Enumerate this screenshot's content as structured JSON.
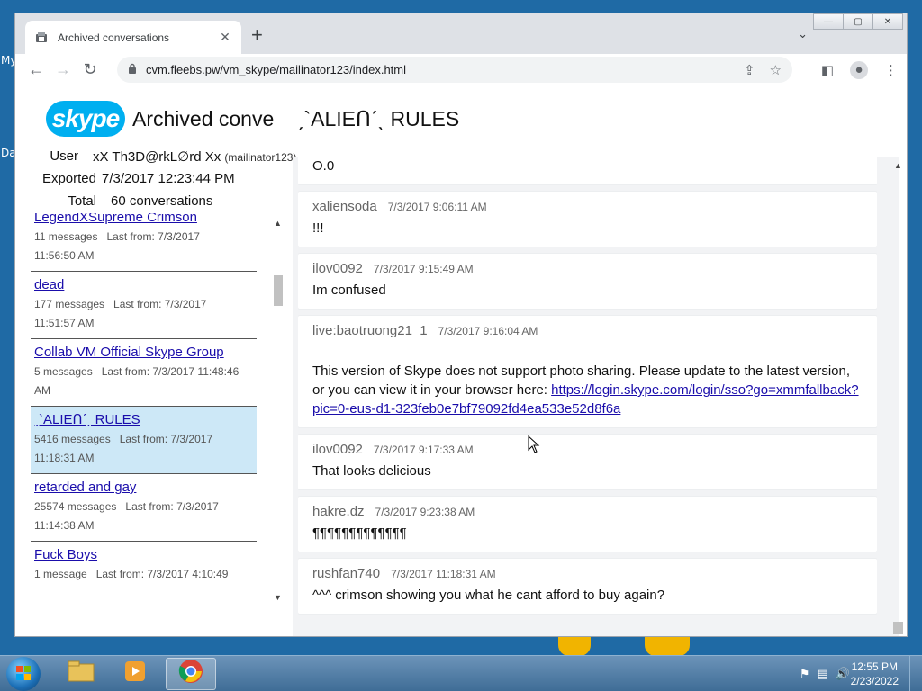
{
  "desktop": {
    "label_top": "My",
    "label_mid": "Da"
  },
  "browser": {
    "tab": {
      "title": "Archived conversations",
      "close": "✕"
    },
    "new_tab": "+",
    "tab_search": "⌄",
    "window_controls": {
      "minimize": "—",
      "maximize": "▢",
      "close": "✕"
    },
    "nav": {
      "back": "←",
      "forward": "→",
      "reload": "↻"
    },
    "address": {
      "lock": "🔒",
      "url": "cvm.fleebs.pw/vm_skype/mailinator123/index.html"
    }
  },
  "page": {
    "logo": "skype",
    "title": "Archived conve    ˏ`ALIEՈˊˎ RULES",
    "meta": {
      "user_key": "User",
      "user_val": "xX Th3D@rkL∅rd Xx",
      "user_id": "(mailinator123)",
      "exported_key": "Exported",
      "exported_val": "7/3/2017 12:23:44 PM",
      "total_key": "Total",
      "total_val": "60 conversations"
    },
    "conversations": [
      {
        "name": "LegendXSupreme Crimson",
        "count": "11 messages",
        "last": "Last from: 7/3/2017",
        "time": "11:56:50 AM"
      },
      {
        "name": "dead",
        "count": "177 messages",
        "last": "Last from: 7/3/2017",
        "time": "11:51:57 AM"
      },
      {
        "name": "Collab VM Official Skype Group",
        "count": "5 messages",
        "last": "Last from: 7/3/2017 11:48:46",
        "time": "AM"
      },
      {
        "name": "ˏ`ALIEՈˊˎ RULES",
        "count": "5416 messages",
        "last": "Last from: 7/3/2017",
        "time": "11:18:31 AM"
      },
      {
        "name": "retarded and gay",
        "count": "25574 messages",
        "last": "Last from: 7/3/2017",
        "time": "11:14:38 AM"
      },
      {
        "name": "Fuck Boys",
        "count": "1 message",
        "last": "Last from: 7/3/2017 4:10:49",
        "time": ""
      }
    ],
    "messages": [
      {
        "user": "",
        "time": "",
        "text": "O.0"
      },
      {
        "user": "xaliensoda",
        "time": "7/3/2017 9:06:11 AM",
        "text": "!!!"
      },
      {
        "user": "ilov0092",
        "time": "7/3/2017 9:15:49 AM",
        "text": "Im confused"
      },
      {
        "user": "live:baotruong21_1",
        "time": "7/3/2017 9:16:04 AM",
        "text": "This version of Skype does not support photo sharing. Please update to the latest version, or you can view it in your browser here: ",
        "link": "https://login.skype.com/login/sso?go=xmmfallback?pic=0-eus-d1-323feb0e7bf79092fd4ea533e52d8f6a"
      },
      {
        "user": "ilov0092",
        "time": "7/3/2017 9:17:33 AM",
        "text": "That looks delicious"
      },
      {
        "user": "hakre.dz",
        "time": "7/3/2017 9:23:38 AM",
        "text": "¶¶¶¶¶¶¶¶¶¶¶¶¶"
      },
      {
        "user": "rushfan740",
        "time": "7/3/2017 11:18:31 AM",
        "text": "^^^ crimson showing you what he cant afford to buy again?"
      }
    ]
  },
  "taskbar": {
    "clock_time": "12:55 PM",
    "clock_date": "2/23/2022"
  }
}
